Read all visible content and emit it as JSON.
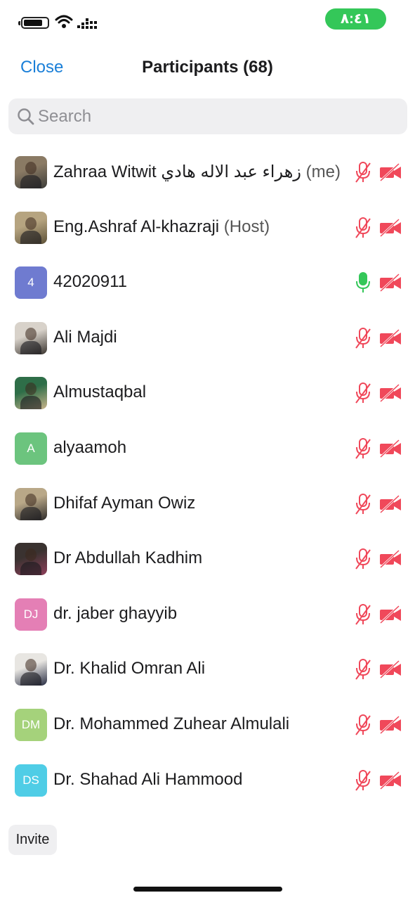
{
  "status_bar": {
    "time": "٨:٤١",
    "time_color": "#34c759"
  },
  "header": {
    "close_label": "Close",
    "title": "Participants (68)"
  },
  "search": {
    "placeholder": "Search"
  },
  "participants": [
    {
      "name": "Zahraa Witwit زهراء عبد الاله هادي",
      "suffix": " (me)",
      "avatar_type": "photo",
      "avatar_colors": [
        "#8a7a64",
        "#3d3d3a"
      ],
      "mic": "muted",
      "video": "off"
    },
    {
      "name": "Eng.Ashraf Al-khazraji",
      "suffix": " (Host)",
      "avatar_type": "photo",
      "avatar_colors": [
        "#b6a480",
        "#5e5238"
      ],
      "mic": "muted",
      "video": "off"
    },
    {
      "name": "42020911",
      "suffix": "",
      "avatar_type": "initials",
      "initials": "4",
      "avatar_color": "#6f7bd0",
      "mic": "on",
      "video": "off"
    },
    {
      "name": "Ali Majdi",
      "suffix": "",
      "avatar_type": "photo",
      "avatar_colors": [
        "#d8d2ca",
        "#3b3530"
      ],
      "mic": "muted",
      "video": "off"
    },
    {
      "name": "Almustaqbal",
      "suffix": "",
      "avatar_type": "photo",
      "avatar_colors": [
        "#2e6e48",
        "#c8b38a"
      ],
      "mic": "muted",
      "video": "off"
    },
    {
      "name": "alyaamoh",
      "suffix": "",
      "avatar_type": "initials",
      "initials": "A",
      "avatar_color": "#6cc47e",
      "mic": "muted",
      "video": "off"
    },
    {
      "name": "Dhifaf Ayman Owiz",
      "suffix": "",
      "avatar_type": "photo",
      "avatar_colors": [
        "#b9a888",
        "#2f2c2a"
      ],
      "mic": "muted",
      "video": "off"
    },
    {
      "name": "Dr Abdullah Kadhim",
      "suffix": "",
      "avatar_type": "photo",
      "avatar_colors": [
        "#3a3230",
        "#8e3f5a"
      ],
      "mic": "muted",
      "video": "off"
    },
    {
      "name": "dr. jaber ghayyib",
      "suffix": "",
      "avatar_type": "initials",
      "initials": "DJ",
      "avatar_color": "#e47fb5",
      "mic": "muted",
      "video": "off"
    },
    {
      "name": "Dr. Khalid Omran Ali",
      "suffix": "",
      "avatar_type": "photo",
      "avatar_colors": [
        "#e8e6e2",
        "#2a2f45"
      ],
      "mic": "muted",
      "video": "off"
    },
    {
      "name": "Dr. Mohammed Zuhear Almulali",
      "suffix": "",
      "avatar_type": "initials",
      "initials": "DM",
      "avatar_color": "#a5d27b",
      "mic": "muted",
      "video": "off"
    },
    {
      "name": "Dr. Shahad Ali Hammood",
      "suffix": "",
      "avatar_type": "initials",
      "initials": "DS",
      "avatar_color": "#4fcde6",
      "mic": "muted",
      "video": "off"
    }
  ],
  "icons": {
    "mic_muted_color": "#f0485a",
    "mic_on_color": "#34c759",
    "video_off_color": "#f0485a"
  },
  "invite": {
    "label": "Invite"
  }
}
